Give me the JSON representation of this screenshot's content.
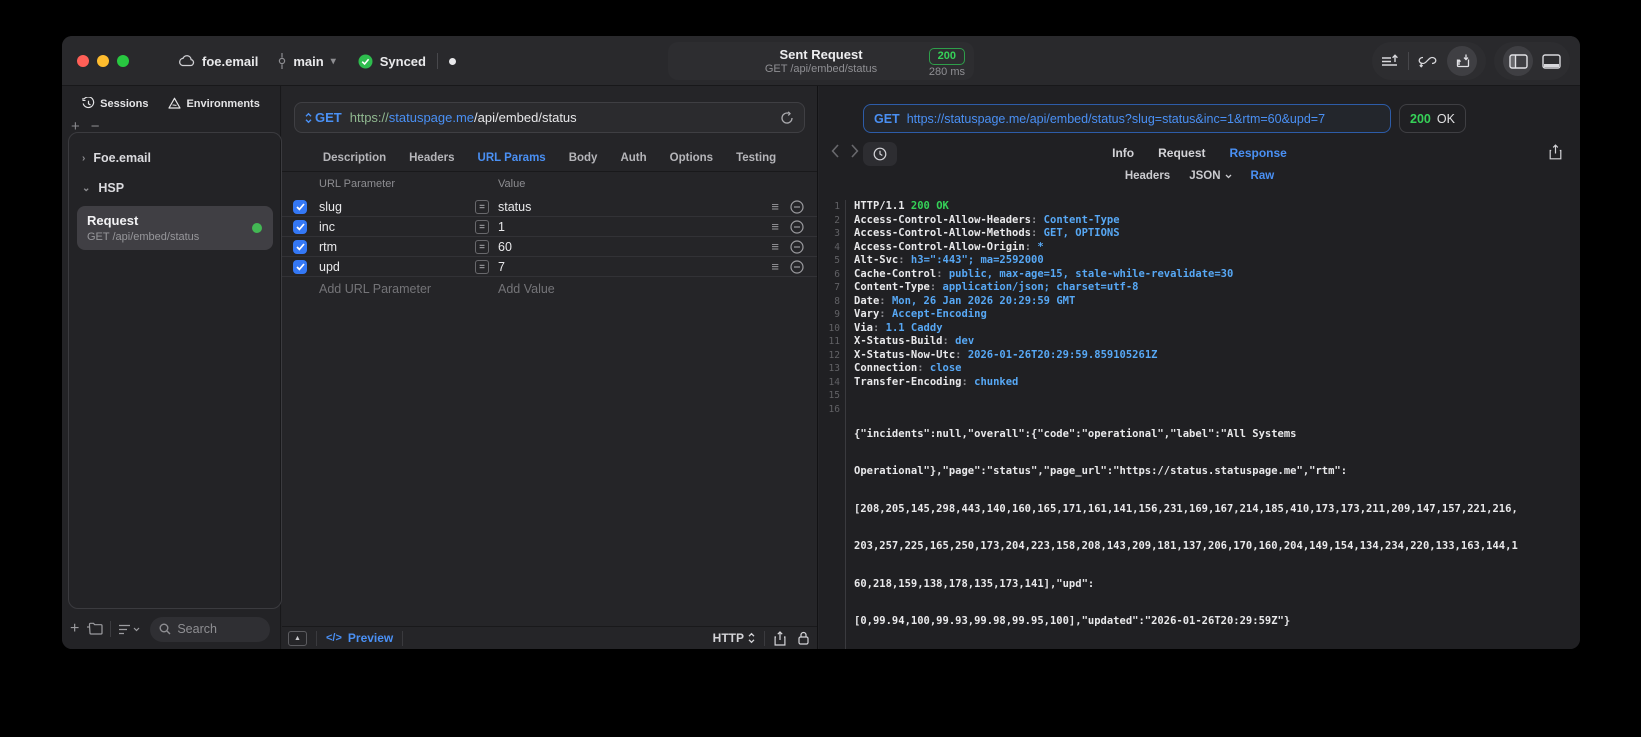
{
  "titlebar": {
    "project_name": "foe.email",
    "branch_name": "main",
    "sync_label": "Synced",
    "request_summary": {
      "title": "Sent Request",
      "subtitle": "GET /api/embed/status",
      "status_code": "200",
      "duration": "280 ms"
    }
  },
  "colors": {
    "accent_blue": "#4a90f4",
    "success_green": "#36d158",
    "checkbox_blue": "#3478f6",
    "response_value_blue": "#57a8f5"
  },
  "sidebar": {
    "tabs": [
      {
        "label": "Sessions",
        "icon": "history-icon"
      },
      {
        "label": "Environments",
        "icon": "environments-icon"
      }
    ],
    "tree": {
      "group_collapsed": "Foe.email",
      "group_expanded": "HSP"
    },
    "request_item": {
      "title": "Request",
      "subtitle": "GET /api/embed/status"
    },
    "search": {
      "placeholder": "Search"
    }
  },
  "request_editor": {
    "method": "GET",
    "url": {
      "scheme": "https://",
      "host": "statuspage.me",
      "path": "/api/embed/status"
    },
    "tabs": [
      "Description",
      "Headers",
      "URL Params",
      "Body",
      "Auth",
      "Options",
      "Testing"
    ],
    "active_tab": "URL Params",
    "params": {
      "col_param": "URL Parameter",
      "col_value": "Value",
      "rows": [
        {
          "name": "slug",
          "value": "status",
          "enabled": true
        },
        {
          "name": "inc",
          "value": "1",
          "enabled": true
        },
        {
          "name": "rtm",
          "value": "60",
          "enabled": true
        },
        {
          "name": "upd",
          "value": "7",
          "enabled": true
        }
      ],
      "add_param_placeholder": "Add URL Parameter",
      "add_value_placeholder": "Add Value"
    },
    "footer": {
      "code_glyph": "</>",
      "preview": "Preview",
      "protocol": "HTTP"
    }
  },
  "response_viewer": {
    "method": "GET",
    "url": "https://statuspage.me/api/embed/status?slug=status&inc=1&rtm=60&upd=7",
    "status_code": "200",
    "status_text": "OK",
    "tabs": [
      "Info",
      "Request",
      "Response"
    ],
    "active_tab": "Response",
    "subtabs": [
      "Headers",
      "JSON",
      "Raw"
    ],
    "active_subtab": "Raw",
    "sep": ": ",
    "status_line": {
      "num": "1",
      "protocol": "HTTP/1.1 ",
      "status": "200 OK"
    },
    "headers": [
      {
        "num": "2",
        "name": "Access-Control-Allow-Headers",
        "value": "Content-Type"
      },
      {
        "num": "3",
        "name": "Access-Control-Allow-Methods",
        "value": "GET, OPTIONS"
      },
      {
        "num": "4",
        "name": "Access-Control-Allow-Origin",
        "value": "*"
      },
      {
        "num": "5",
        "name": "Alt-Svc",
        "value": "h3=\":443\"; ma=2592000"
      },
      {
        "num": "6",
        "name": "Cache-Control",
        "value": "public, max-age=15, stale-while-revalidate=30"
      },
      {
        "num": "7",
        "name": "Content-Type",
        "value": "application/json; charset=utf-8"
      },
      {
        "num": "8",
        "name": "Date",
        "value": "Mon, 26 Jan 2026 20:29:59 GMT"
      },
      {
        "num": "9",
        "name": "Vary",
        "value": "Accept-Encoding"
      },
      {
        "num": "10",
        "name": "Via",
        "value": "1.1 Caddy"
      },
      {
        "num": "11",
        "name": "X-Status-Build",
        "value": "dev"
      },
      {
        "num": "12",
        "name": "X-Status-Now-Utc",
        "value": "2026-01-26T20:29:59.859105261Z"
      },
      {
        "num": "13",
        "name": "Connection",
        "value": "close"
      },
      {
        "num": "14",
        "name": "Transfer-Encoding",
        "value": "chunked"
      }
    ],
    "blank_line": {
      "num": "15"
    },
    "body": {
      "num": "16",
      "lines": [
        "{\"incidents\":null,\"overall\":{\"code\":\"operational\",\"label\":\"All Systems",
        "Operational\"},\"page\":\"status\",\"page_url\":\"https://status.statuspage.me\",\"rtm\":",
        "[208,205,145,298,443,140,160,165,171,161,141,156,231,169,167,214,185,410,173,173,211,209,147,157,221,216,",
        "203,257,225,165,250,173,204,223,158,208,143,209,181,137,206,170,160,204,149,154,134,234,220,133,163,144,1",
        "60,218,159,138,178,135,173,141],\"upd\":",
        "[0,99.94,100,99.93,99.98,99.95,100],\"updated\":\"2026-01-26T20:29:59Z\"}"
      ]
    }
  }
}
